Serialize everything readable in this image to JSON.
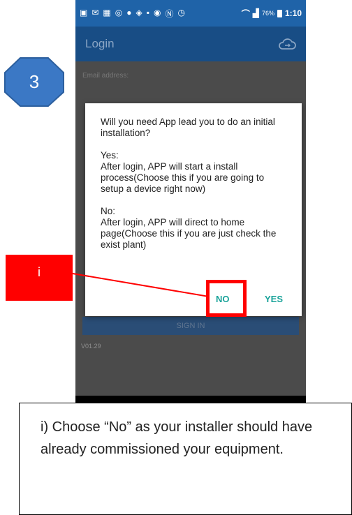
{
  "step_number": "3",
  "status_bar": {
    "battery": "76%",
    "time": "1:10",
    "icons": [
      "message-icon",
      "gmail-icon",
      "image-icon",
      "chrome-icon",
      "chat-icon",
      "navigation-icon",
      "gallery-icon",
      "nfc-icon",
      "n-icon",
      "alarm-icon",
      "wifi-icon",
      "signal-icon",
      "battery-icon"
    ]
  },
  "app_bar": {
    "title": "Login",
    "icon": "cloud-icon"
  },
  "form": {
    "email_label": "Email address:",
    "sign_in_label": "SIGN IN",
    "version": "V01.29"
  },
  "dialog": {
    "question": "Will you need App lead you to do an initial installation?",
    "yes_text": "Yes:\n After login, APP will start a install process(Choose this if you are going to setup a device right now)",
    "no_text": "No:\n After login, APP will direct to home page(Choose this if you are just check the exist plant)",
    "no_button": "NO",
    "yes_button": "YES"
  },
  "annotation": {
    "marker_label": "i",
    "highlight_color": "#ff0000",
    "note": "i) Choose “No” as your installer should have already commissioned your equipment."
  },
  "colors": {
    "status_bar": "#1f63a8",
    "app_bar": "#184d85",
    "accent": "#1aa39a",
    "badge": "#3b78c5"
  }
}
